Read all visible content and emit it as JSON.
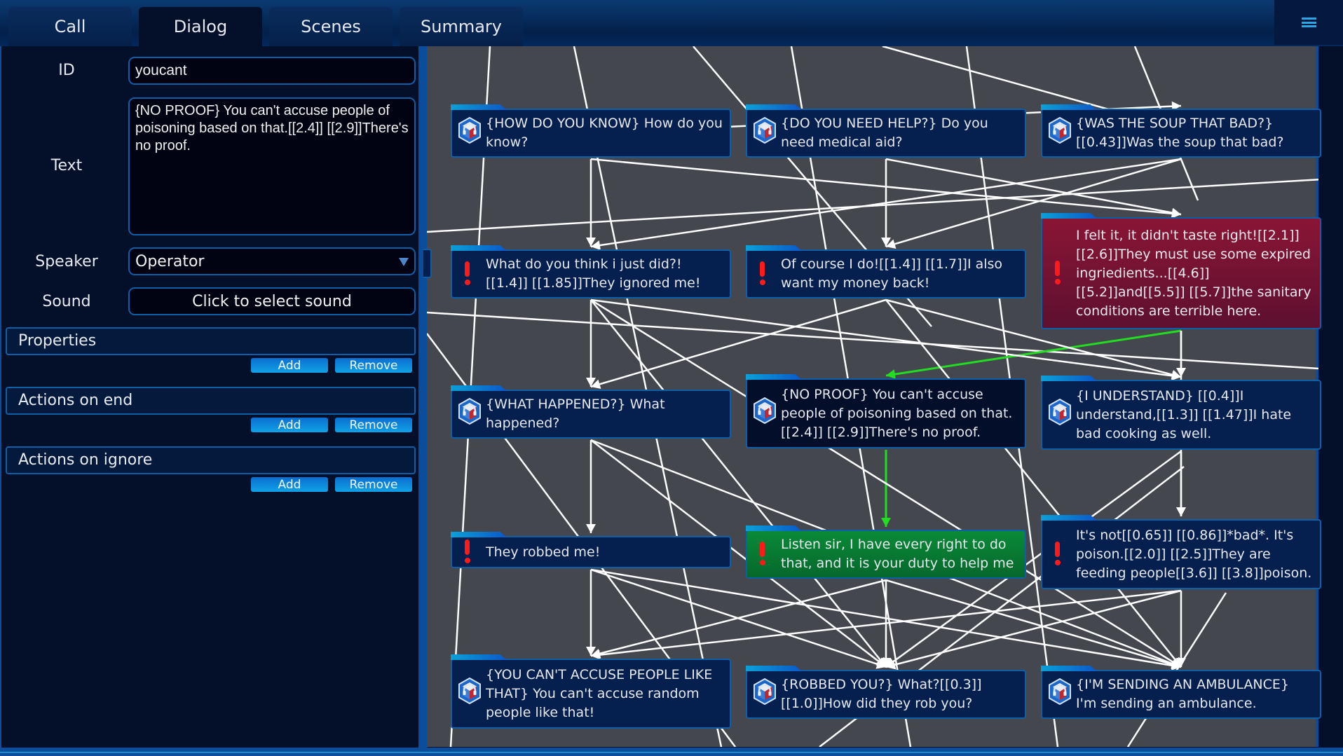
{
  "tabs": [
    {
      "label": "Call",
      "active": false
    },
    {
      "label": "Dialog",
      "active": true
    },
    {
      "label": "Scenes",
      "active": false
    },
    {
      "label": "Summary",
      "active": false
    }
  ],
  "menu_icon": "hamburger-menu-icon",
  "editor": {
    "id_label": "ID",
    "id_value": "youcant",
    "text_label": "Text",
    "text_value": "{NO PROOF} You can't accuse people of poisoning based on that.[[2.4]] [[2.9]]There's no proof.",
    "speaker_label": "Speaker",
    "speaker_value": "Operator",
    "sound_label": "Sound",
    "sound_button": "Click to select sound",
    "sections": [
      {
        "title": "Properties",
        "add": "Add",
        "remove": "Remove"
      },
      {
        "title": "Actions on end",
        "add": "Add",
        "remove": "Remove"
      },
      {
        "title": "Actions on ignore",
        "add": "Add",
        "remove": "Remove"
      }
    ]
  },
  "graph": {
    "colors": {
      "edge": "#ffffff",
      "active_edge": "#22dd22",
      "operator_node": "#05204f",
      "caller_node_highlight_red": "#8a1535",
      "caller_node_highlight_green": "#0a8a38",
      "selected_node": "#030e2a",
      "exclamation": "#ff1a1a"
    },
    "nodes": [
      {
        "id": "n1",
        "speaker": "operator",
        "icon": "operator-headset-icon",
        "state": "normal",
        "text": "{HOW DO YOU KNOW} How do you know?"
      },
      {
        "id": "n2",
        "speaker": "operator",
        "icon": "operator-headset-icon",
        "state": "normal",
        "text": "{DO YOU NEED HELP?} Do you need medical aid?"
      },
      {
        "id": "n3",
        "speaker": "operator",
        "icon": "operator-headset-icon",
        "state": "normal",
        "text": "{WAS THE SOUP THAT BAD?} [[0.43]]Was the soup that bad?"
      },
      {
        "id": "n4",
        "speaker": "caller",
        "icon": "exclamation-icon",
        "state": "normal",
        "text": "What do you think i just did?![[1.4]] [[1.85]]They ignored me!"
      },
      {
        "id": "n5",
        "speaker": "caller",
        "icon": "exclamation-icon",
        "state": "normal",
        "text": "Of course I do![[1.4]] [[1.7]]I also want my money back!"
      },
      {
        "id": "n6",
        "speaker": "caller",
        "icon": "exclamation-icon",
        "state": "red",
        "text": "I felt it, it didn't taste right![[2.1]] [[2.6]]They must use some expired ingriedients...[[4.6]] [[5.2]]and[[5.5]] [[5.7]]the sanitary conditions are terrible here."
      },
      {
        "id": "n7",
        "speaker": "operator",
        "icon": "operator-headset-icon",
        "state": "normal",
        "text": "{WHAT HAPPENED?} What happened?"
      },
      {
        "id": "n8",
        "speaker": "operator",
        "icon": "operator-headset-icon",
        "state": "selected",
        "text": "{NO PROOF} You can't accuse people of poisoning based on that.[[2.4]] [[2.9]]There's no proof."
      },
      {
        "id": "n9",
        "speaker": "operator",
        "icon": "operator-headset-icon",
        "state": "normal",
        "text": "{I UNDERSTAND} [[0.4]]I understand,[[1.3]] [[1.47]]I hate bad cooking as well."
      },
      {
        "id": "n10",
        "speaker": "caller",
        "icon": "exclamation-icon",
        "state": "normal",
        "text": "They robbed me!"
      },
      {
        "id": "n11",
        "speaker": "caller",
        "icon": "exclamation-icon",
        "state": "green",
        "text": "Listen sir, I have every right to do that, and it is your duty to help me"
      },
      {
        "id": "n12",
        "speaker": "caller",
        "icon": "exclamation-icon",
        "state": "normal",
        "text": "It's not[[0.65]] [[0.86]]*bad*. It's poison.[[2.0]] [[2.5]]They are feeding people[[3.6]] [[3.8]]poison."
      },
      {
        "id": "n13",
        "speaker": "operator",
        "icon": "operator-headset-icon",
        "state": "normal",
        "text": "{YOU CAN'T ACCUSE PEOPLE LIKE THAT} You can't accuse random people like that!"
      },
      {
        "id": "n14",
        "speaker": "operator",
        "icon": "operator-headset-icon",
        "state": "normal",
        "text": "{ROBBED YOU?} What?[[0.3]] [[1.0]]How did they rob you?"
      },
      {
        "id": "n15",
        "speaker": "operator",
        "icon": "operator-headset-icon",
        "state": "normal",
        "text": "{I'M SENDING AN AMBULANCE} I'm sending an ambulance."
      }
    ],
    "edges": [
      {
        "from": "n6",
        "to": "n8",
        "active": true
      },
      {
        "from": "n8",
        "to": "n11",
        "active": true
      },
      {
        "from": "n1",
        "to": "n4"
      },
      {
        "from": "n1",
        "to": "n6"
      },
      {
        "from": "n2",
        "to": "n5"
      },
      {
        "from": "n3",
        "to": "n4"
      },
      {
        "from": "n4",
        "to": "n7"
      },
      {
        "from": "n4",
        "to": "n9"
      },
      {
        "from": "n4",
        "to": "n14"
      },
      {
        "from": "n4",
        "to": "n15"
      },
      {
        "from": "n5",
        "to": "n7"
      },
      {
        "from": "n5",
        "to": "n9"
      },
      {
        "from": "n5",
        "to": "n15"
      },
      {
        "from": "n6",
        "to": "n9"
      },
      {
        "from": "n6",
        "to": "n12"
      },
      {
        "from": "n7",
        "to": "n10"
      },
      {
        "from": "n7",
        "to": "n15"
      },
      {
        "from": "n9",
        "to": "n12"
      },
      {
        "from": "n10",
        "to": "n13"
      },
      {
        "from": "n10",
        "to": "n14"
      },
      {
        "from": "n10",
        "to": "n15"
      },
      {
        "from": "n11",
        "to": "n13"
      },
      {
        "from": "n11",
        "to": "n14"
      },
      {
        "from": "n11",
        "to": "n15"
      },
      {
        "from": "n12",
        "to": "n13"
      },
      {
        "from": "n12",
        "to": "n14"
      },
      {
        "from": "n12",
        "to": "n15"
      },
      {
        "from": "n2",
        "to": "n6"
      },
      {
        "from": "n3",
        "to": "n5"
      },
      {
        "from": "n1",
        "to": "n3"
      },
      {
        "from": "n9",
        "to": "n14"
      },
      {
        "from": "n7",
        "to": "n14"
      }
    ]
  }
}
